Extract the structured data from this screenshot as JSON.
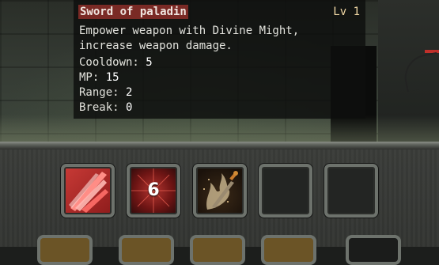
{
  "skill_tooltip": {
    "title": "Sword of paladin",
    "level": "Lv 1",
    "description": "Empower weapon with Divine Might, increase weapon damage.",
    "stats": [
      {
        "label": "Cooldown:",
        "value": "5"
      },
      {
        "label": "MP:",
        "value": "15"
      },
      {
        "label": "Range:",
        "value": "2"
      },
      {
        "label": "Break:",
        "value": "0"
      }
    ]
  },
  "skill_bar": {
    "slots": [
      {
        "icon": "red-slash-icon",
        "state": "ready"
      },
      {
        "icon": "cooldown-burst-icon",
        "cooldown": "6"
      },
      {
        "icon": "flaming-sword-icon",
        "state": "ready"
      },
      {
        "icon": "empty-slot",
        "state": "empty"
      },
      {
        "icon": "empty-slot",
        "state": "empty"
      }
    ]
  },
  "colors": {
    "title_highlight": "#7a2a25",
    "level_text": "#f0d7a5",
    "slot_border": "#6d726c",
    "enemy_health": "#c0302a"
  }
}
